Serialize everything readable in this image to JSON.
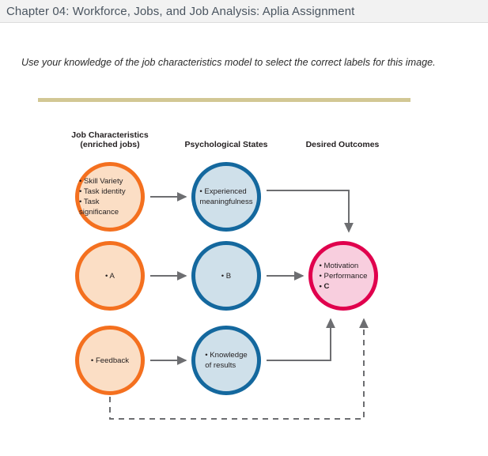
{
  "header": {
    "title": "Chapter 04: Workforce, Jobs, and Job Analysis: Aplia Assignment"
  },
  "instruction": {
    "text": "Use your knowledge of the job characteristics model to select the correct labels for this image."
  },
  "diagram": {
    "columns": [
      {
        "label": "Job Characteristics\n(enriched jobs)"
      },
      {
        "label": "Psychological States"
      },
      {
        "label": "Desired Outcomes"
      }
    ],
    "nodes": {
      "job_characteristics": [
        {
          "id": "jc1",
          "text": "• Skill Variety\n• Task identity\n• Task significance",
          "color": "#f4701f",
          "fill": "#fbdec5"
        },
        {
          "id": "jc2",
          "text": "• A",
          "color": "#f4701f",
          "fill": "#fbdec5",
          "is_placeholder": true
        },
        {
          "id": "jc3",
          "text": "• Feedback",
          "color": "#f4701f",
          "fill": "#fbdec5"
        }
      ],
      "psychological_states": [
        {
          "id": "ps1",
          "text": "• Experienced\n  meaningfulness",
          "color": "#14689e",
          "fill": "#cfe0ea"
        },
        {
          "id": "ps2",
          "text": "• B",
          "color": "#14689e",
          "fill": "#cfe0ea",
          "is_placeholder": true
        },
        {
          "id": "ps3",
          "text": "• Knowledge\n  of results",
          "color": "#14689e",
          "fill": "#cfe0ea"
        }
      ],
      "desired_outcomes": [
        {
          "id": "do1",
          "line1": "• Motivation",
          "line2": "• Performance",
          "line3": "• C",
          "color": "#e0004d",
          "fill": "#f8cede"
        }
      ]
    },
    "connectors": {
      "arrow_color": "#6d6e71",
      "solid_count": 5,
      "dashed_count": 1,
      "dashed_description": "feedback loop from Feedback node to Desired Outcomes node"
    }
  },
  "colors": {
    "header_bg": "#f2f2f2",
    "header_text": "#4a5560",
    "gold_divider": "#d2c794",
    "orange": "#f4701f",
    "orange_fill": "#fbdec5",
    "blue": "#14689e",
    "blue_fill": "#cfe0ea",
    "pink": "#e0004d",
    "pink_fill": "#f8cede",
    "connector": "#6d6e71"
  }
}
